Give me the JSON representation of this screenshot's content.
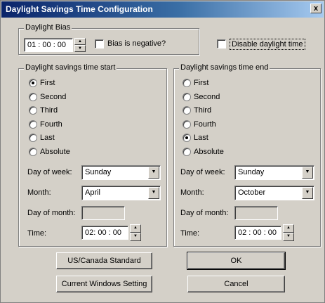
{
  "window": {
    "title": "Daylight Savings Time Configuration",
    "close_glyph": "x"
  },
  "bias": {
    "group_label": "Daylight Bias",
    "value": "01 : 00 : 00",
    "negative_label": "Bias is negative?",
    "negative_checked": false,
    "disable_label": "Disable daylight time",
    "disable_checked": false
  },
  "start": {
    "group_label": "Daylight savings time start",
    "options": [
      "First",
      "Second",
      "Third",
      "Fourth",
      "Last",
      "Absolute"
    ],
    "selected": "First",
    "day_of_week_label": "Day of week:",
    "day_of_week": "Sunday",
    "month_label": "Month:",
    "month": "April",
    "day_of_month_label": "Day of month:",
    "day_of_month": "",
    "time_label": "Time:",
    "time": "02: 00 : 00"
  },
  "end": {
    "group_label": "Daylight savings time end",
    "options": [
      "First",
      "Second",
      "Third",
      "Fourth",
      "Last",
      "Absolute"
    ],
    "selected": "Last",
    "day_of_week_label": "Day of week:",
    "day_of_week": "Sunday",
    "month_label": "Month:",
    "month": "October",
    "day_of_month_label": "Day of month:",
    "day_of_month": "",
    "time_label": "Time:",
    "time": "02 : 00 : 00"
  },
  "buttons": {
    "us_canada": "US/Canada Standard",
    "current_windows": "Current Windows Setting",
    "ok": "OK",
    "cancel": "Cancel"
  },
  "glyphs": {
    "spin_up": "▲",
    "spin_down": "▼",
    "combo_arrow": "▼"
  },
  "colors": {
    "face": "#d4d0c8",
    "title_start": "#0a246a",
    "title_end": "#a6caf0"
  }
}
